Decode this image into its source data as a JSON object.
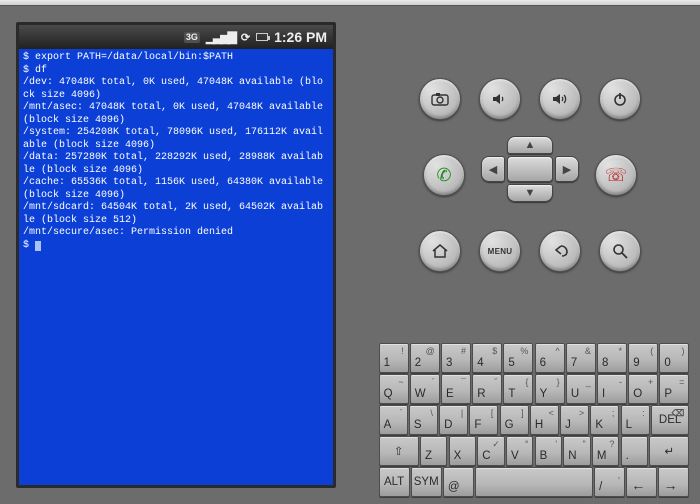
{
  "status": {
    "network": "3G",
    "time": "1:26 PM"
  },
  "terminal": {
    "lines": [
      "$ export PATH=/data/local/bin:$PATH",
      "$ df",
      "/dev: 47048K total, 0K used, 47048K available (block size 4096)",
      "/mnt/asec: 47048K total, 0K used, 47048K available (block size 4096)",
      "/system: 254208K total, 78096K used, 176112K available (block size 4096)",
      "/data: 257280K total, 228292K used, 28988K available (block size 4096)",
      "/cache: 65536K total, 1156K used, 64380K available (block size 4096)",
      "/mnt/sdcard: 64504K total, 2K used, 64502K available (block size 512)",
      "/mnt/secure/asec: Permission denied",
      "$ "
    ]
  },
  "buttons": {
    "row1": [
      "camera",
      "vol-down",
      "vol-up",
      "power"
    ],
    "row2": [
      "call",
      "dpad",
      "end-call"
    ],
    "row3": [
      "home",
      "menu",
      "back",
      "search"
    ],
    "menu_label": "MENU"
  },
  "keyboard": {
    "rows": [
      [
        [
          "1",
          "!"
        ],
        [
          "2",
          "@"
        ],
        [
          "3",
          "#"
        ],
        [
          "4",
          "$"
        ],
        [
          "5",
          "%"
        ],
        [
          "6",
          "^"
        ],
        [
          "7",
          "&"
        ],
        [
          "8",
          "*"
        ],
        [
          "9",
          "("
        ],
        [
          "0",
          ")"
        ]
      ],
      [
        [
          "Q",
          "~"
        ],
        [
          "W",
          "´"
        ],
        [
          "E",
          "¯"
        ],
        [
          "R",
          "ˇ"
        ],
        [
          "T",
          "{"
        ],
        [
          "Y",
          "}"
        ],
        [
          "U",
          "_"
        ],
        [
          "I",
          "-"
        ],
        [
          "O",
          "+"
        ],
        [
          "P",
          "="
        ]
      ],
      [
        [
          "A",
          "`"
        ],
        [
          "S",
          "\\"
        ],
        [
          "D",
          "|"
        ],
        [
          "F",
          "["
        ],
        [
          "G",
          "]"
        ],
        [
          "H",
          "<"
        ],
        [
          "J",
          ">"
        ],
        [
          "K",
          ";"
        ],
        [
          "L",
          ":"
        ],
        [
          "DEL",
          "⌫"
        ]
      ],
      [
        [
          "⇧",
          ""
        ],
        [
          "Z",
          ""
        ],
        [
          "X",
          ""
        ],
        [
          "C",
          "✓"
        ],
        [
          "V",
          "°"
        ],
        [
          "B",
          "'"
        ],
        [
          "N",
          "\""
        ],
        [
          "M",
          "?"
        ],
        [
          ".",
          ""
        ],
        [
          "↵",
          ""
        ]
      ],
      [
        [
          "ALT",
          ""
        ],
        [
          "SYM",
          ""
        ],
        [
          "@",
          ""
        ],
        [
          "SPACE",
          ""
        ],
        [
          "/",
          ","
        ],
        [
          "←",
          ""
        ],
        [
          "→",
          ""
        ]
      ]
    ]
  }
}
